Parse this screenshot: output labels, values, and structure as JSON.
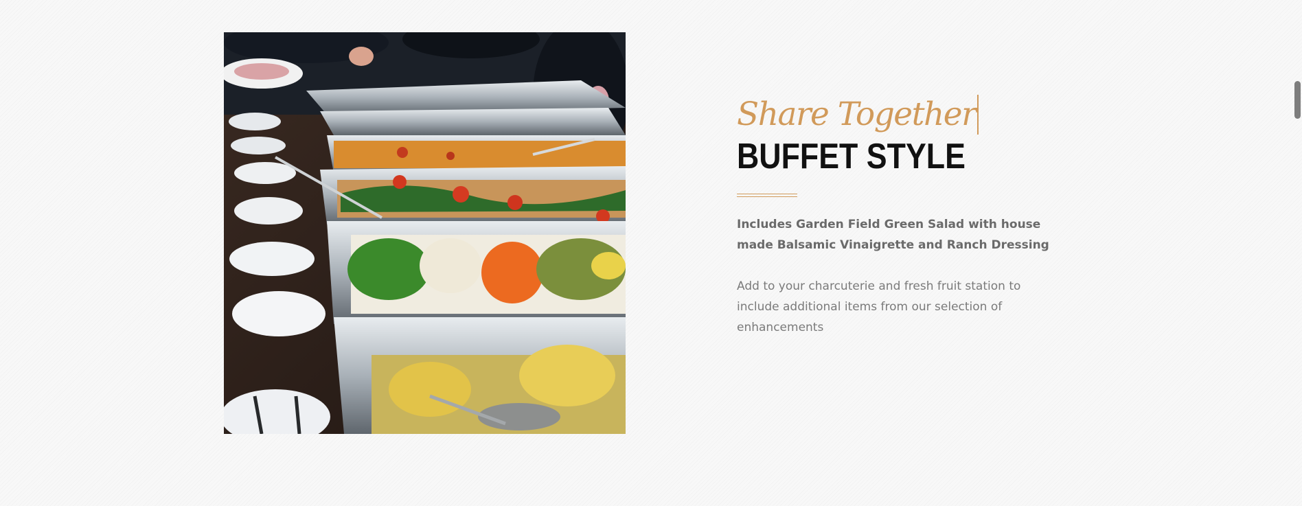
{
  "section": {
    "script_heading": "Share Together",
    "heading": "BUFFET STYLE",
    "lead_text": "Includes Garden Field Green Salad with house made Balsamic Vinaigrette and Ranch Dressing",
    "body_text": "Add to your charcuterie and fresh fruit station to include additional items from our selection of enhancements"
  },
  "image": {
    "subject": "buffet-food-trays-photo"
  },
  "colors": {
    "accent": "#d19a5a",
    "heading": "#111111",
    "text": "#7a7a7a",
    "background": "#f8f8f8"
  }
}
